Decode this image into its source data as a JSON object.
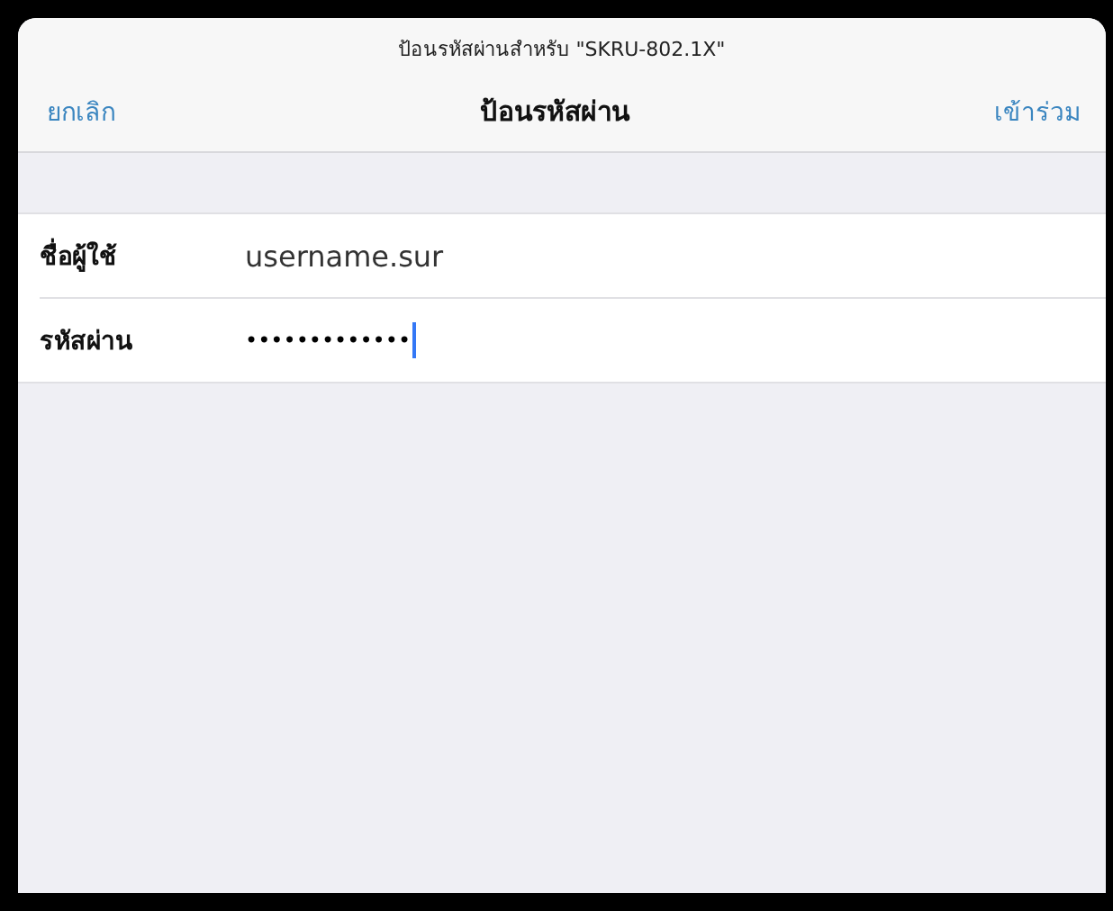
{
  "header": {
    "prompt": "ป้อนรหัสผ่านสำหรับ \"SKRU-802.1X\"",
    "title": "ป้อนรหัสผ่าน",
    "cancel": "ยกเลิก",
    "join": "เข้าร่วม"
  },
  "fields": [
    {
      "label": "ชื่อผู้ใช้",
      "value": "username.sur",
      "focused": false
    },
    {
      "label": "รหัสผ่าน",
      "value": "•••••••••••••",
      "focused": true
    }
  ]
}
